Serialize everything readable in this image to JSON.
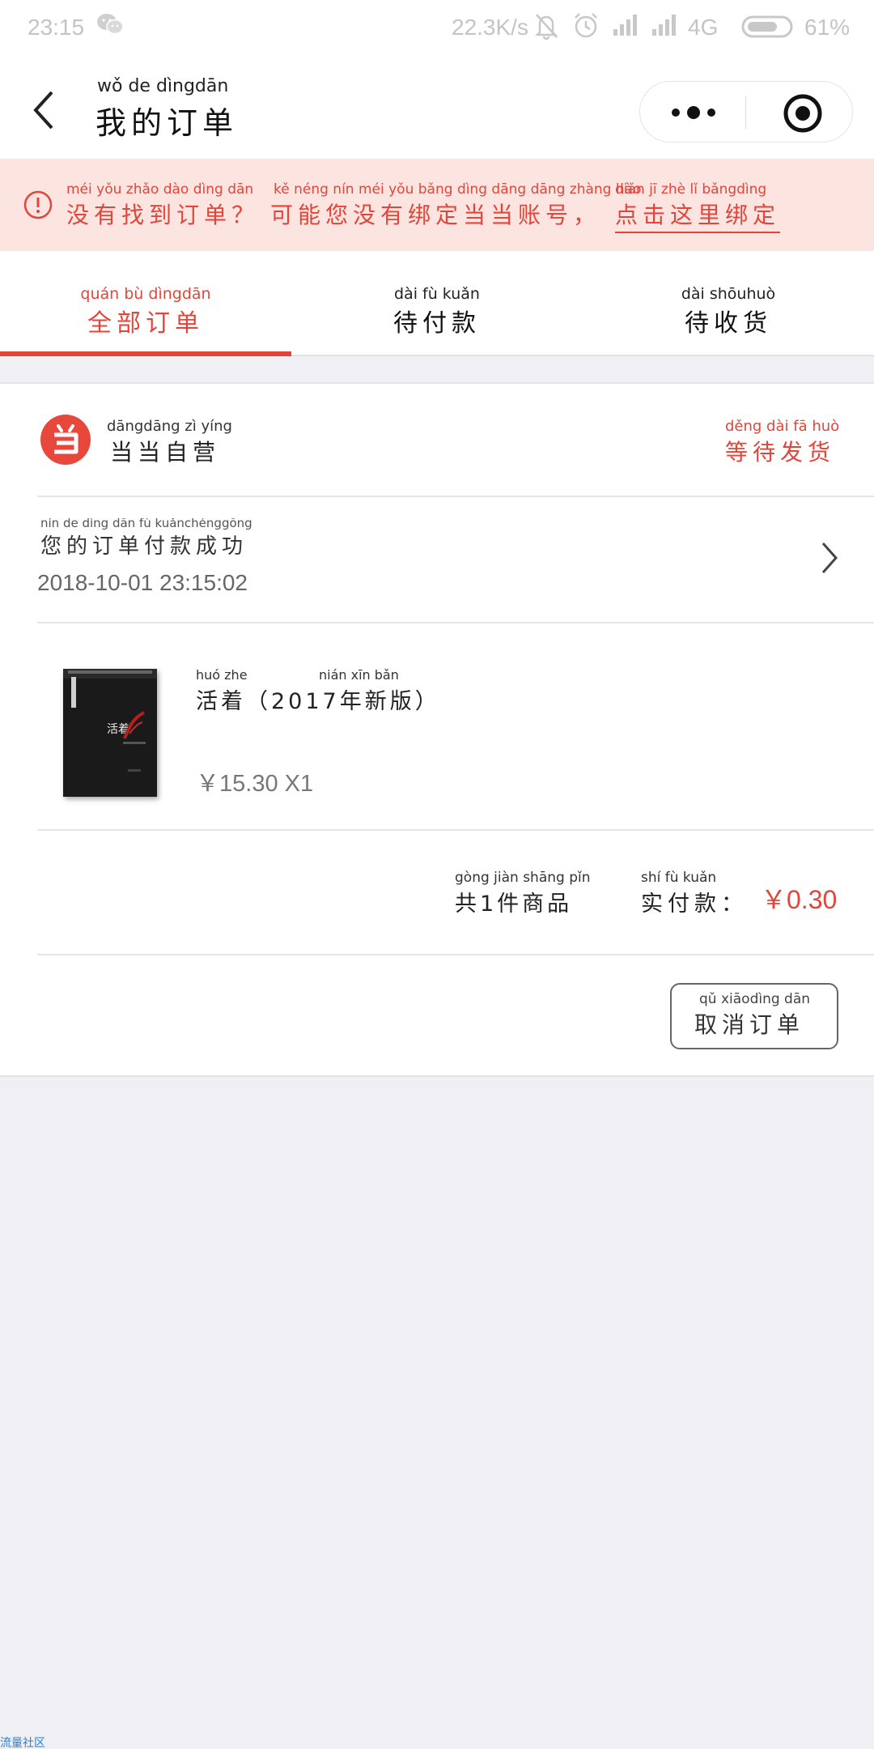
{
  "status_bar": {
    "time": "23:15",
    "speed": "22.3K/s",
    "network": "4G",
    "battery": "61%",
    "icons": [
      "wechat-icon",
      "mute-bell-icon",
      "alarm-icon",
      "signal-icon",
      "battery-icon"
    ]
  },
  "nav": {
    "title_pinyin": "wǒ  de  dìngdān",
    "title": "我的订单"
  },
  "notice": {
    "pinyin_1": "méi yǒu zhǎo dào dìng dān",
    "text_1": "没有找到订单？",
    "pinyin_2": "kě néng nín méi yǒu bǎng dìng dāng dāng zhàng hào",
    "text_2": "可能您没有绑定当当账号，",
    "link_pinyin": "diǎn  jī  zhè  lǐ  bǎngdìng",
    "link_text": "点击这里绑定"
  },
  "tabs": [
    {
      "pinyin": "quán bù dìngdān",
      "label": "全部订单",
      "active": true
    },
    {
      "pinyin": "dài  fù  kuǎn",
      "label": "待付款",
      "active": false
    },
    {
      "pinyin": "dài shōuhuò",
      "label": "待收货",
      "active": false
    }
  ],
  "order": {
    "store_pinyin": "dāngdāng  zì  yíng",
    "store": "当当自营",
    "status_pinyin": "děng dài  fā  huò",
    "status": "等待发货",
    "message_pinyin": "nín  de  dìng dān  fù kuǎnchénggōng",
    "message": "您的订单付款成功",
    "timestamp": "2018-10-01 23:15:02",
    "item": {
      "name_pinyin_1": "huó zhe",
      "name_pinyin_2": "nián xīn bǎn",
      "name": "活着（2017年新版）",
      "price": "￥15.30 X1",
      "cover_title": "活着"
    },
    "summary_pinyin": "gòng  jiàn shāng pǐn",
    "summary": "共1件商品",
    "paid_pinyin": "shí  fù kuǎn",
    "paid_label": "实付款：",
    "paid_amount": "￥0.30",
    "cancel_pinyin": "qǔ xiāodìng dān",
    "cancel_label": "取消订单"
  },
  "watermark": "流量社区",
  "colors": {
    "accent": "#e2463b",
    "notice_bg": "#fce4e0",
    "page_bg": "#efeff4"
  }
}
